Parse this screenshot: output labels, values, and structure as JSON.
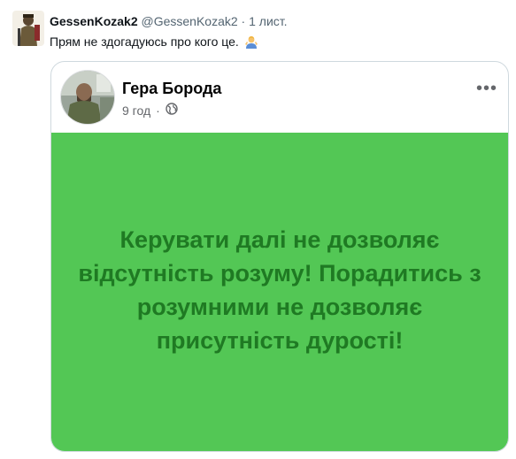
{
  "tweet": {
    "display_name": "GessenKozak2",
    "handle": "@GessenKozak2",
    "separator": "·",
    "time": "1 лист.",
    "text": "Прям не здогадуюсь про кого це.",
    "emoji_icon": "person-shrugging-emoji"
  },
  "facebook_post": {
    "author": "Гера Борода",
    "time": "9 год",
    "separator": "·",
    "privacy_icon": "globe-icon",
    "more_icon": "more-dots-icon",
    "more_label": "•••",
    "background_color": "#53c755",
    "text_color": "#1f7a23",
    "text": "Керувати далі не дозволяє відсутність розуму! Порадитись з розумними не дозволяє присутність дурості!"
  }
}
